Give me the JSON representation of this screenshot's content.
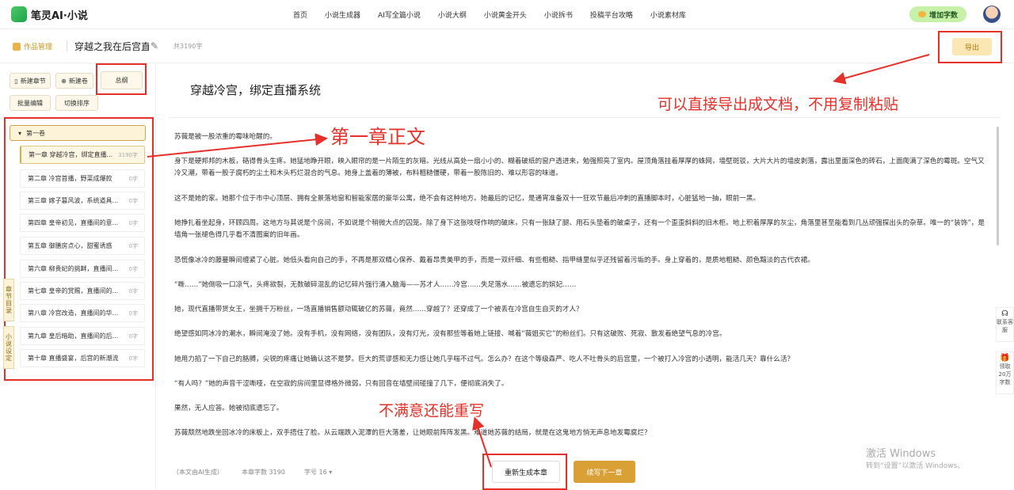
{
  "nav": {
    "logo": "笔灵AI·小说",
    "links": [
      "首页",
      "小说生成器",
      "AI写全篇小说",
      "小说大纲",
      "小说黄金开头",
      "小说拆书",
      "投稿平台攻略",
      "小说素材库"
    ],
    "add_words": "增加字数"
  },
  "header": {
    "works": "作品管理",
    "title": "穿越之我在后宫直播",
    "total": "共3190字",
    "export": "导出"
  },
  "sidebar": {
    "new_chapter": "新建章节",
    "new_volume": "新建卷",
    "outline": "总纲",
    "batch_edit": "批量编辑",
    "switch_sort": "切换排序",
    "volume": "第一卷",
    "chapters": [
      {
        "name": "第一章 穿越冷宫，绑定直播...",
        "count": "3190字"
      },
      {
        "name": "第二章 冷宫首播，野菜成爆款",
        "count": "0字"
      },
      {
        "name": "第三章 嫁子篡风波，系统道具...",
        "count": "0字"
      },
      {
        "name": "第四章 皇帝初见，直播间的意...",
        "count": "0字"
      },
      {
        "name": "第五章 御膳房点心，甜蜜诱惑",
        "count": "0字"
      },
      {
        "name": "第六章 柳贵妃的挑衅，直播间...",
        "count": "0字"
      },
      {
        "name": "第七章 皇帝的赏赐，直播间的...",
        "count": "0字"
      },
      {
        "name": "第八章 冷宫改造，直播间的华...",
        "count": "0字"
      },
      {
        "name": "第九章 皇后暗助，直播间的后...",
        "count": "0字"
      },
      {
        "name": "第十章 直播盛宴，后宫的新潮流",
        "count": "0字"
      }
    ],
    "tab_catalog": "章节目录",
    "tab_settings": "小说设定"
  },
  "main": {
    "chapter_title": "穿越冷宫，绑定直播系统",
    "paragraphs": [
      "苏薇是被一股浓重的霉味呛醒的。",
      "身下是硬邦邦的木板，硌得骨头生疼。她猛地睁开眼，映入眼帘的是一片陌生的灰暗。光线从高处一扇小小的、糊着破纸的窗户透进来，勉强照亮了室内。屋顶角落挂着厚厚的蛛网，墙壁斑驳，大片大片的墙皮剥落，露出里面深色的砖石，上面爬满了深色的霉斑。空气又冷又潮，带着一股子腐朽的尘土和木头朽烂混合的气息。她身上盖着的薄被，布料粗糙僵硬，带着一股陈旧的、难以形容的味道。",
      "这不是她的家。她那个位于市中心顶层、拥有全景落地窗和智能家居的豪华公寓，绝不会有这种地方。她最后的记忆，是通宵准备双十一狂欢节最后冲刺的直播脚本时，心脏猛地一抽，眼前一黑。",
      "她挣扎着坐起身，环顾四周。这地方与其说是个房间，不如说是个稍微大点的囚笼。除了身下这张吱呀作响的破床，只有一张缺了腿、用石头垫着的破桌子，还有一个歪歪斜斜的旧木柜。地上积着厚厚的灰尘，角落里甚至能看到几丛顽强探出头的杂草。唯一的“装饰”，是墙角一张褪色得几乎看不清图案的旧年画。",
      "恐慌像冰冷的藤蔓瞬间缠紧了心脏。她低头看向自己的手，不再是那双精心保养、戴着昂贵美甲的手，而是一双纤细、有些粗糙、指甲缝里似乎还残留着污垢的手。身上穿着的，是质地粗糙、颜色黯淡的古代衣裙。",
      "“嘶……”她倒吸一口凉气，头疼欲裂，无数破碎混乱的记忆碎片强行涌入脑海——苏才人……冷宫……失足落水……被遗忘的嫔妃……",
      "她，现代直播带货女王，坐拥千万粉丝，一场直播销售额动辄破亿的苏薇，竟然……穿越了？还穿成了一个被丢在冷宫自生自灭的才人？",
      "绝望感如同冰冷的潮水，瞬间淹没了她。没有手机，没有网络，没有团队，没有灯光，没有那些等着她上链接、喊着“薇姐买它”的粉丝们。只有这破败、死寂、散发着绝望气息的冷宫。",
      "她用力掐了一下自己的胳膊，尖锐的疼痛让她确认这不是梦。巨大的荒谬感和无力感让她几乎喘不过气。怎么办？在这个等级森严、吃人不吐骨头的后宫里，一个被打入冷宫的小透明，能活几天？靠什么活？",
      "“有人吗？”她的声音干涩嘶哑，在空寂的房间里显得格外微弱，只有回音在墙壁间碰撞了几下，便彻底消失了。",
      "果然，无人应答。她被彻底遗忘了。",
      "苏薇颓然地跌坐回冰冷的床板上，双手捂住了脸。从云端跌入泥潭的巨大落差，让她眼前阵阵发黑。难道她苏薇的结局，就是在这鬼地方悄无声息地发霉腐烂？"
    ],
    "footnote": "（本文由AI生成）",
    "chapter_words": "本章字数 3190",
    "font_size": "字号 16",
    "regen": "重新生成本章",
    "continue": "续写下一章"
  },
  "float": {
    "contact": "联系客服",
    "claim": "领取20万字数"
  },
  "annotations": {
    "export_note": "可以直接导出成文档，不用复制粘贴",
    "chapter_note": "第一章正文",
    "regen_note": "不满意还能重写"
  },
  "watermark": {
    "line1": "激活 Windows",
    "line2": "转到“设置”以激活 Windows。"
  },
  "colors": {
    "accent": "#d9a035",
    "annotation": "#e6302a",
    "green": "#1ea34a"
  }
}
